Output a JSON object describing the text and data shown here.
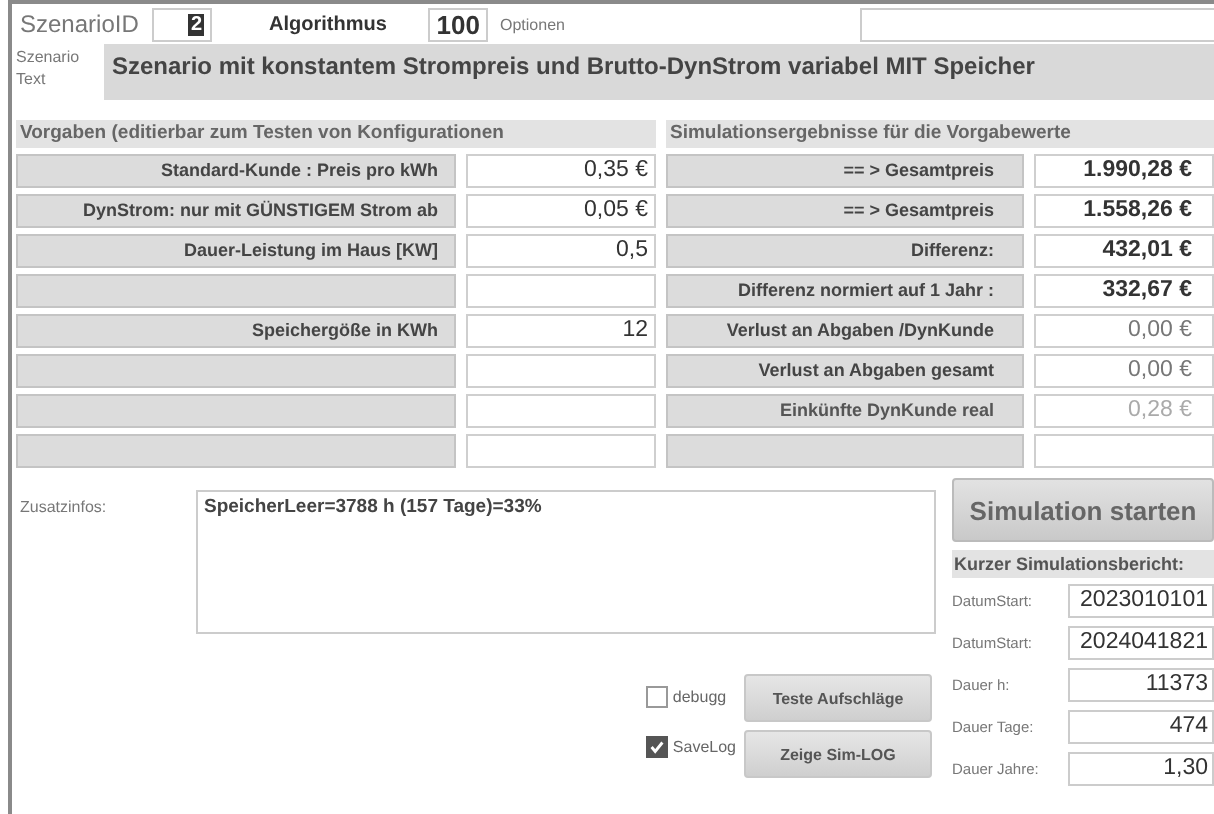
{
  "header": {
    "id_label": "SzenarioID",
    "id_value": "2",
    "algo_label": "Algorithmus",
    "algo_value": "100",
    "options_label": "Optionen",
    "text_label": "Szenario Text",
    "text_value": "Szenario mit konstantem Strompreis und Brutto-DynStrom variabel MIT Speicher"
  },
  "inputs": {
    "title": "Vorgaben (editierbar zum Testen von Konfigurationen",
    "rows": [
      {
        "label": "Standard-Kunde : Preis pro kWh",
        "value": "0,35 €"
      },
      {
        "label": "DynStrom: nur mit GÜNSTIGEM Strom ab",
        "value": "0,05 €"
      },
      {
        "label": "Dauer-Leistung im Haus [KW]",
        "value": "0,5"
      },
      {
        "label": "",
        "value": ""
      },
      {
        "label": "Speichergöße in KWh",
        "value": "12"
      },
      {
        "label": "",
        "value": ""
      },
      {
        "label": "",
        "value": ""
      },
      {
        "label": "",
        "value": ""
      }
    ]
  },
  "results": {
    "title": "Simulationsergebnisse für die Vorgabewerte",
    "rows": [
      {
        "label": "== > Gesamtpreis",
        "value": "1.990,28 €",
        "kind": "bold"
      },
      {
        "label": "== > Gesamtpreis",
        "value": "1.558,26 €",
        "kind": "bold"
      },
      {
        "label": "Differenz:",
        "value": "432,01 €",
        "kind": "bold"
      },
      {
        "label": "Differenz normiert auf 1 Jahr :",
        "value": "332,67 €",
        "kind": "bold"
      },
      {
        "label": "Verlust an Abgaben /DynKunde",
        "value": "0,00 €",
        "kind": "plain"
      },
      {
        "label": "Verlust an Abgaben gesamt",
        "value": "0,00 €",
        "kind": "plain"
      },
      {
        "label": "Einkünfte DynKunde real",
        "value": "0,28 €",
        "kind": "dim"
      },
      {
        "label": "",
        "value": "",
        "kind": "plain"
      }
    ]
  },
  "info": {
    "label": "Zusatzinfos:",
    "value": "SpeicherLeer=3788 h (157 Tage)=33%"
  },
  "checkboxes": [
    {
      "label": "debugg",
      "checked": false
    },
    {
      "label": "SaveLog",
      "checked": true
    }
  ],
  "buttons": [
    "Teste Aufschläge",
    "Zeige Sim-LOG"
  ],
  "start_button": "Simulation starten",
  "report": {
    "title": "Kurzer Simulationsbericht:",
    "rows": [
      {
        "label": "DatumStart:",
        "value": "2023010101"
      },
      {
        "label": "DatumStart:",
        "value": "2024041821"
      },
      {
        "label": "Dauer h:",
        "value": "11373"
      },
      {
        "label": "Dauer Tage:",
        "value": "474"
      },
      {
        "label": "Dauer Jahre:",
        "value": "1,30"
      }
    ]
  }
}
